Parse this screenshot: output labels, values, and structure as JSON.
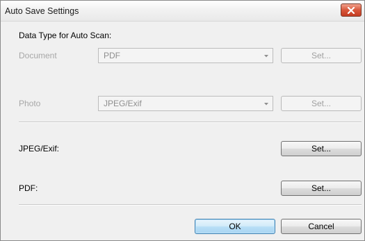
{
  "window": {
    "title": "Auto Save Settings"
  },
  "auto_scan": {
    "heading": "Data Type for Auto Scan:",
    "rows": [
      {
        "label": "Document",
        "value": "PDF",
        "set_label": "Set..."
      },
      {
        "label": "Photo",
        "value": "JPEG/Exif",
        "set_label": "Set..."
      }
    ]
  },
  "format_settings": {
    "jpeg_label": "JPEG/Exif:",
    "jpeg_set_label": "Set...",
    "pdf_label": "PDF:",
    "pdf_set_label": "Set..."
  },
  "footer": {
    "ok_label": "OK",
    "cancel_label": "Cancel"
  },
  "colors": {
    "accent": "#3c7fb1",
    "close": "#d8573b",
    "disabled_text": "#a7a7a7"
  }
}
